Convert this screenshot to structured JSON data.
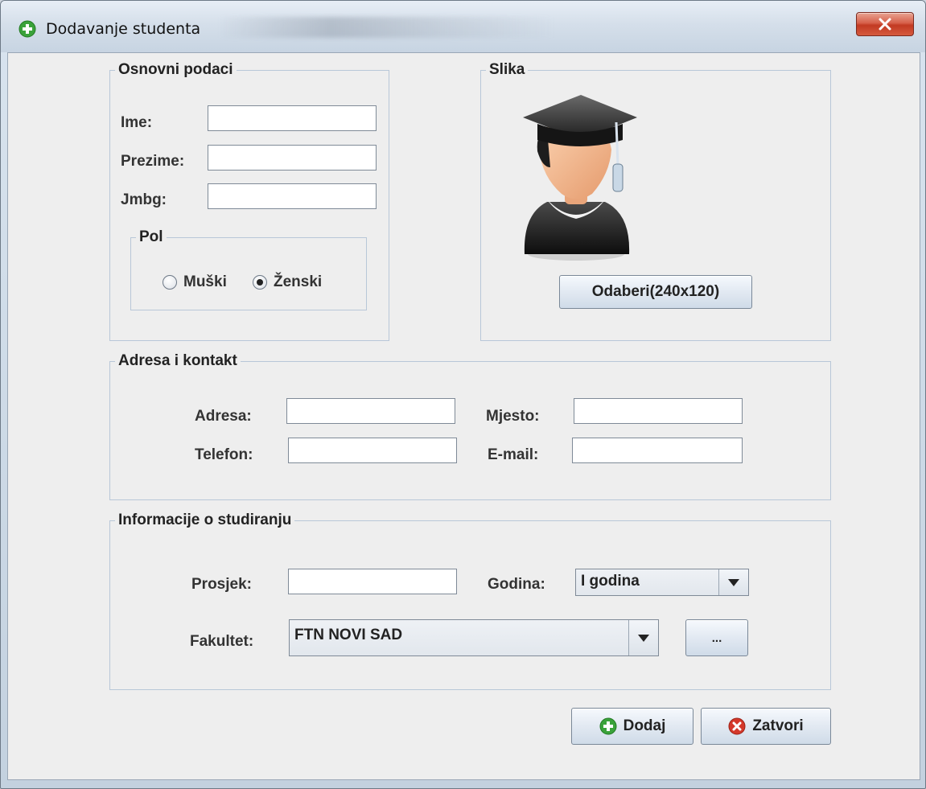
{
  "window": {
    "title": "Dodavanje studenta"
  },
  "basic": {
    "legend": "Osnovni podaci",
    "ime_label": "Ime:",
    "ime_value": "",
    "prezime_label": "Prezime:",
    "prezime_value": "",
    "jmbg_label": "Jmbg:",
    "jmbg_value": "",
    "pol": {
      "legend": "Pol",
      "options": [
        "Muški",
        "Ženski"
      ],
      "selected": "Ženski"
    }
  },
  "picture": {
    "legend": "Slika",
    "choose_button": "Odaberi(240x120)"
  },
  "address": {
    "legend": "Adresa i kontakt",
    "adresa_label": "Adresa:",
    "adresa_value": "",
    "mjesto_label": "Mjesto:",
    "mjesto_value": "",
    "telefon_label": "Telefon:",
    "telefon_value": "",
    "email_label": "E-mail:",
    "email_value": ""
  },
  "study": {
    "legend": "Informacije o studiranju",
    "prosjek_label": "Prosjek:",
    "prosjek_value": "",
    "godina_label": "Godina:",
    "godina_selected": "I godina",
    "fakultet_label": "Fakultet:",
    "fakultet_selected": "FTN NOVI SAD",
    "more_button": "..."
  },
  "actions": {
    "add_button": "Dodaj",
    "close_button": "Zatvori"
  },
  "colors": {
    "add_icon": "#3aa23a",
    "close_icon": "#d4382a"
  }
}
